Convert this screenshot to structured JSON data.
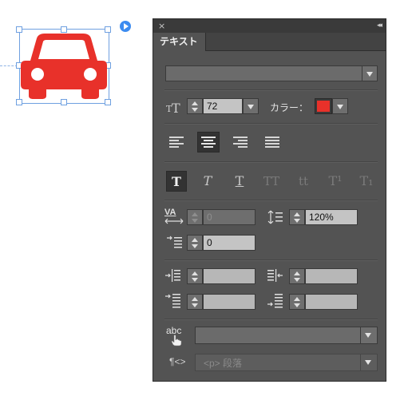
{
  "canvas": {
    "car_color": "#e8312a",
    "selection_color": "#6fa0e0",
    "icon": "car-icon"
  },
  "panel": {
    "close_glyph": "×",
    "collapse_glyph": "◂◂",
    "tab_label": "テキスト",
    "font_family_value": "",
    "font_size": {
      "icon": "font-size-icon",
      "value": "72"
    },
    "color": {
      "label": "カラー：",
      "value": "#e8312a"
    },
    "alignment": [
      "align-left",
      "align-center",
      "align-right",
      "align-justify"
    ],
    "alignment_selected": "align-center",
    "styles": [
      {
        "name": "bold",
        "glyph": "T"
      },
      {
        "name": "italic",
        "glyph": "T"
      },
      {
        "name": "underline",
        "glyph": "T"
      },
      {
        "name": "all-caps",
        "glyph": "TT"
      },
      {
        "name": "small-caps",
        "glyph": "tt"
      },
      {
        "name": "superscript",
        "glyph": "T¹"
      },
      {
        "name": "subscript",
        "glyph": "T₁"
      }
    ],
    "tracking": {
      "icon": "tracking-icon",
      "icon_text": "VA",
      "value": "0"
    },
    "line_height": {
      "icon": "line-height-icon",
      "value": "120%"
    },
    "first_indent": {
      "icon": "first-line-indent-icon",
      "value": "0"
    },
    "left_indent": {
      "icon": "left-indent-icon",
      "value": ""
    },
    "right_indent": {
      "icon": "right-indent-icon",
      "value": ""
    },
    "space_before": {
      "icon": "space-before-icon",
      "value": ""
    },
    "space_after": {
      "icon": "space-after-icon",
      "value": ""
    },
    "char_style": {
      "icon": "character-style-icon",
      "icon_text": "abc",
      "value": ""
    },
    "para_style": {
      "icon": "paragraph-style-icon",
      "icon_text": "¶<>",
      "value": "<p> 段落"
    }
  }
}
